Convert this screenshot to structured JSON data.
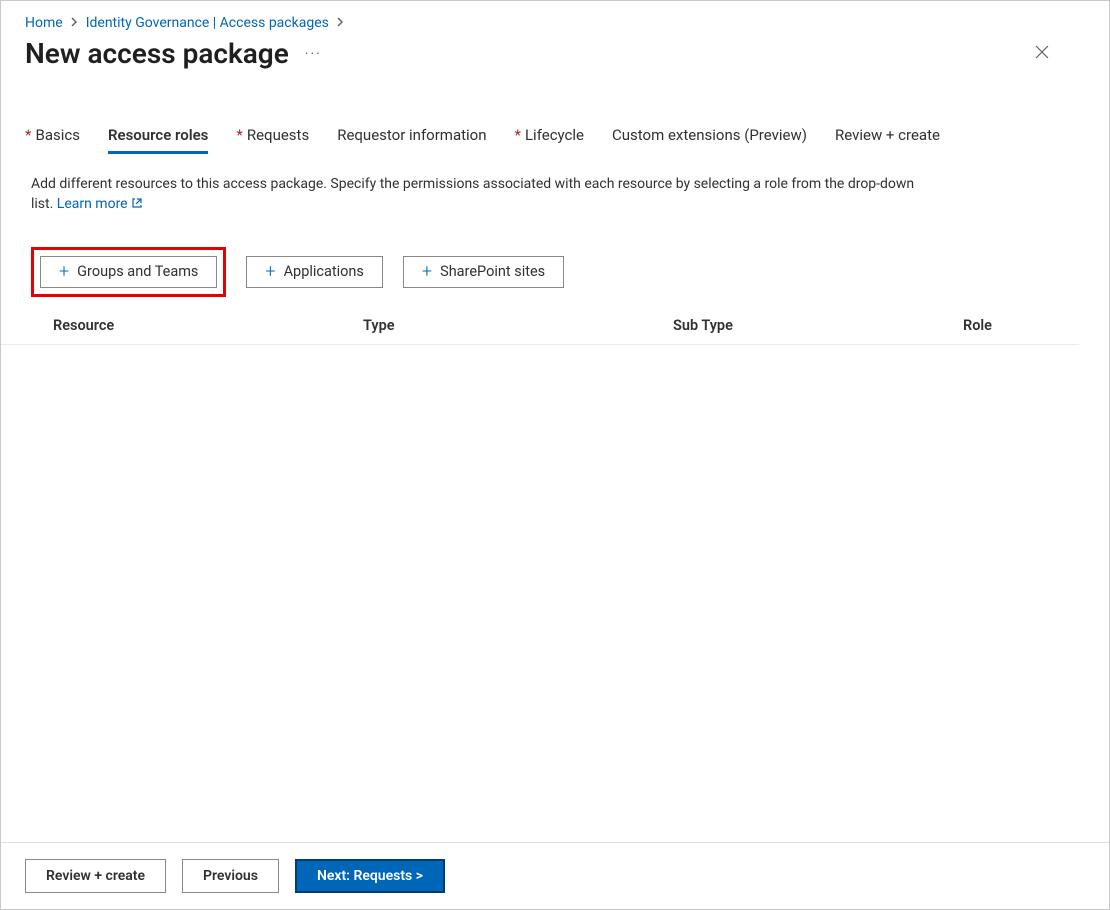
{
  "breadcrumb": {
    "home": "Home",
    "section": "Identity Governance | Access packages"
  },
  "page_title": "New access package",
  "tabs": [
    {
      "label": "Basics",
      "required": true,
      "active": false
    },
    {
      "label": "Resource roles",
      "required": false,
      "active": true
    },
    {
      "label": "Requests",
      "required": true,
      "active": false
    },
    {
      "label": "Requestor information",
      "required": false,
      "active": false
    },
    {
      "label": "Lifecycle",
      "required": true,
      "active": false
    },
    {
      "label": "Custom extensions (Preview)",
      "required": false,
      "active": false
    },
    {
      "label": "Review + create",
      "required": false,
      "active": false
    }
  ],
  "description": {
    "text": "Add different resources to this access package. Specify the permissions associated with each resource by selecting a role from the drop-down list. ",
    "link": "Learn more"
  },
  "add_buttons": {
    "groups": "Groups and Teams",
    "apps": "Applications",
    "sp": "SharePoint sites"
  },
  "table": {
    "headers": {
      "resource": "Resource",
      "type": "Type",
      "subtype": "Sub Type",
      "role": "Role"
    }
  },
  "footer": {
    "review": "Review + create",
    "prev": "Previous",
    "next": "Next: Requests >"
  }
}
